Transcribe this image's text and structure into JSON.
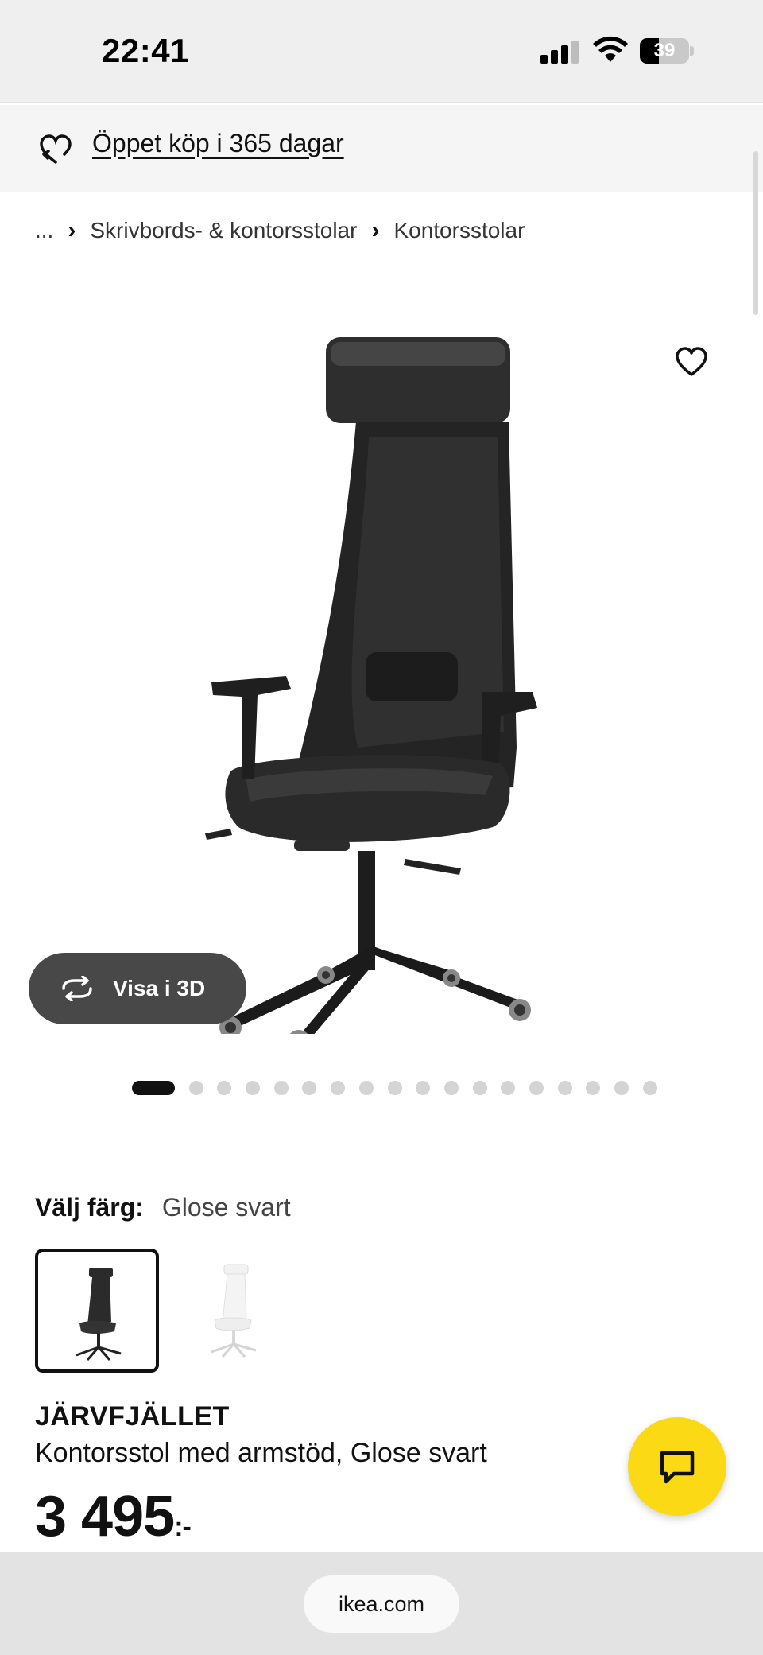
{
  "status_bar": {
    "time": "22:41",
    "battery_level": "39",
    "icons": [
      "signal-icon",
      "wifi-icon",
      "battery-icon"
    ]
  },
  "promo": {
    "text": "Öppet köp i 365 dagar",
    "icon": "return-heart-icon"
  },
  "breadcrumb": {
    "items": [
      "...",
      "Skrivbords- & kontorsstolar",
      "Kontorsstolar"
    ],
    "separator": "›"
  },
  "gallery": {
    "view_3d_label": "Visa i 3D",
    "dot_count": 18,
    "active_dot": 1,
    "favorite_icon": "heart-icon"
  },
  "color_picker": {
    "label": "Välj färg:",
    "selected": "Glose svart",
    "swatches": [
      {
        "color": "#2b2b2b",
        "selected": true
      },
      {
        "color": "#eeeeee",
        "selected": false
      }
    ]
  },
  "product": {
    "name": "JÄRVFJÄLLET",
    "description": "Kontorsstol med armstöd, Glose svart",
    "price": "3 495",
    "price_suffix": ":-"
  },
  "chat": {
    "icon": "chat-bubble-icon",
    "color": "#fbd914"
  },
  "browser": {
    "url": "ikea.com"
  }
}
